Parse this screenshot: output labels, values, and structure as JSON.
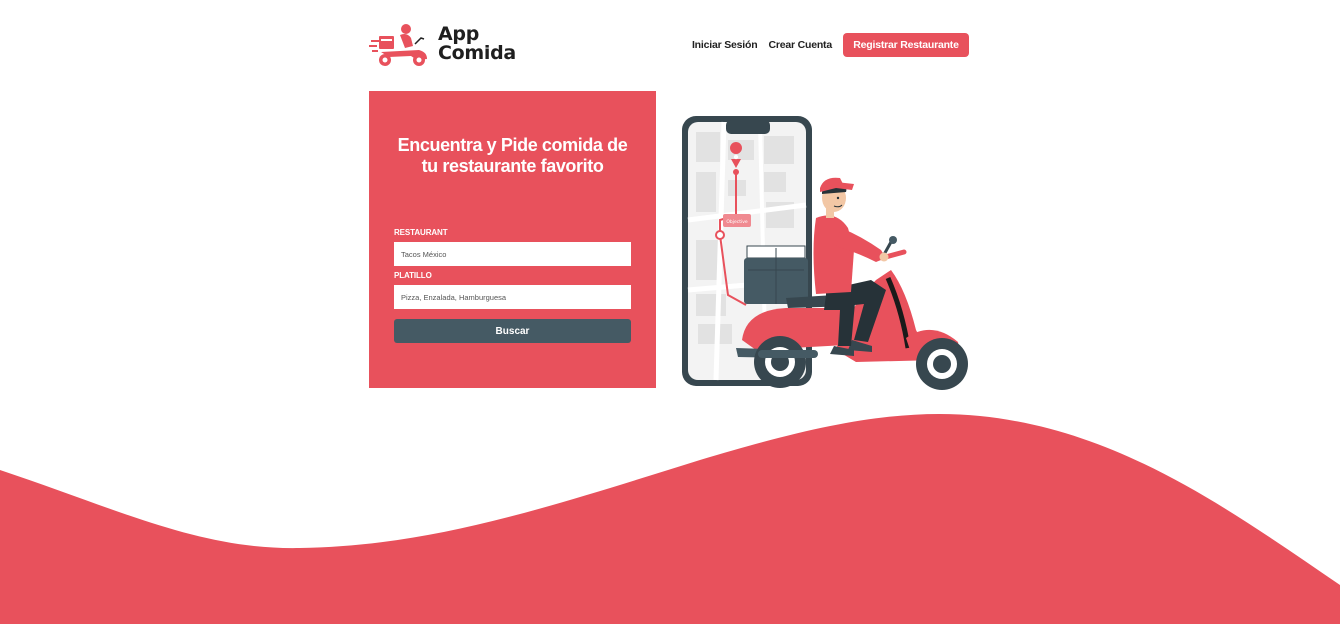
{
  "brand": {
    "name_line1": "App",
    "name_line2": "Comida",
    "logo_icon": "delivery-scooter-icon"
  },
  "nav": {
    "login_label": "Iniciar Sesión",
    "signup_label": "Crear Cuenta",
    "register_restaurant_label": "Registrar Restaurante"
  },
  "search": {
    "title": "Encuentra y Pide comida de tu restaurante favorito",
    "restaurant_label": "RESTAURANT",
    "restaurant_placeholder": "Tacos México",
    "dish_label": "PLATILLO",
    "dish_placeholder": "Pizza, Enzalada, Hamburguesa",
    "button_label": "Buscar"
  },
  "illustration": {
    "name": "delivery-rider-illustration",
    "map_tag": "Objective"
  },
  "colors": {
    "accent": "#e8515c",
    "button_dark": "#455a64",
    "text_dark": "#1f1f1f"
  }
}
